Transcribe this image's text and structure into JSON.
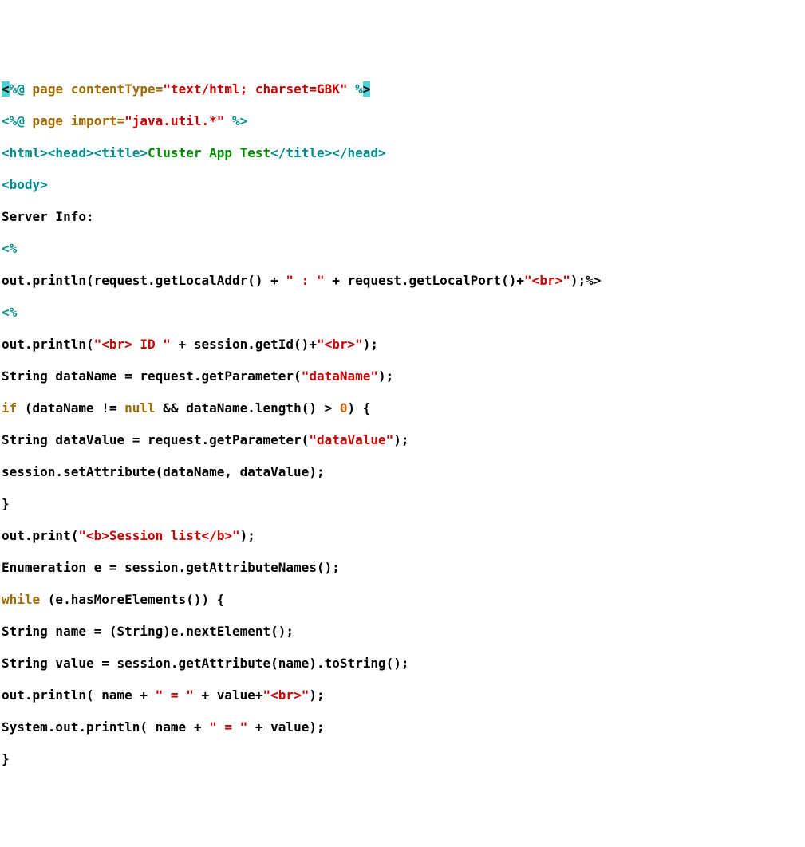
{
  "lines": {
    "l1": {
      "a": "<",
      "b": "%@ ",
      "c": "page ",
      "d": "contentType=",
      "e": "\"text/html; charset=GBK\"",
      "f": " %",
      "g": ">"
    },
    "l2": {
      "a": "<%@ ",
      "b": "page ",
      "c": "import=",
      "d": "\"java.util.*\"",
      "e": " %>"
    },
    "l3": {
      "a": "<html><head><title>",
      "b": "Cluster App Test",
      "c": "</title></head>"
    },
    "l4": {
      "a": "<body>"
    },
    "l5": {
      "a": "Server Info:"
    },
    "l6": {
      "a": "<%"
    },
    "l7": {
      "a": "out.println(request.getLocalAddr() + ",
      "b": "\" : \"",
      "c": " + request.getLocalPort()+",
      "d": "\"<br>\"",
      "e": ");%>"
    },
    "l8": {
      "a": "<%"
    },
    "l9": {
      "a": "out.println(",
      "b": "\"<br> ID \"",
      "c": " + session.getId()+",
      "d": "\"<br>\"",
      "e": ");"
    },
    "l10": {
      "a": "String dataName = request.getParameter(",
      "b": "\"dataName\"",
      "c": ");"
    },
    "l11": {
      "a": "if ",
      "b": "(dataName != ",
      "c": "null",
      "d": " && dataName.length() > ",
      "e": "0",
      "f": ") {"
    },
    "l12": {
      "a": "String dataValue = request.getParameter(",
      "b": "\"dataValue\"",
      "c": ");"
    },
    "l13": {
      "a": "session.setAttribute(dataName, dataValue);"
    },
    "l14": {
      "a": "}"
    },
    "l15": {
      "a": "out.print(",
      "b": "\"<b>Session list</b>\"",
      "c": ");"
    },
    "l16": {
      "a": "Enumeration e = session.getAttributeNames();"
    },
    "l17": {
      "a": "while ",
      "b": "(e.hasMoreElements()) {"
    },
    "l18": {
      "a": "String name = (String)e.nextElement();"
    },
    "l19": {
      "a": "String value = session.getAttribute(name).toString();"
    },
    "l20": {
      "a": "out.println( name + ",
      "b": "\" = \"",
      "c": " + value+",
      "d": "\"<br>\"",
      "e": ");"
    },
    "l21": {
      "a": "System.out.println( name + ",
      "b": "\" = \"",
      "c": " + value);"
    },
    "l22": {
      "a": "}"
    }
  }
}
